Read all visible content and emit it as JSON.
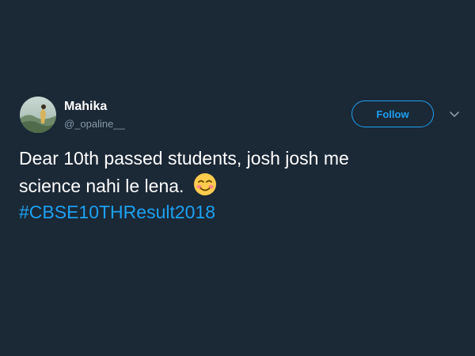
{
  "author": {
    "display_name": "Mahika",
    "handle": "@_opaline__"
  },
  "actions": {
    "follow_label": "Follow"
  },
  "tweet": {
    "text_line1": "Dear 10th passed students, josh josh me",
    "text_line2": "science nahi le lena.",
    "emoji": "smiling-face-with-blush",
    "hashtag": "#CBSE10THResult2018"
  },
  "colors": {
    "background": "#1b2836",
    "accent": "#1da1f2",
    "muted": "#8899a6",
    "text": "#ffffff"
  },
  "icons": {
    "more_menu": "chevron-down-icon"
  }
}
